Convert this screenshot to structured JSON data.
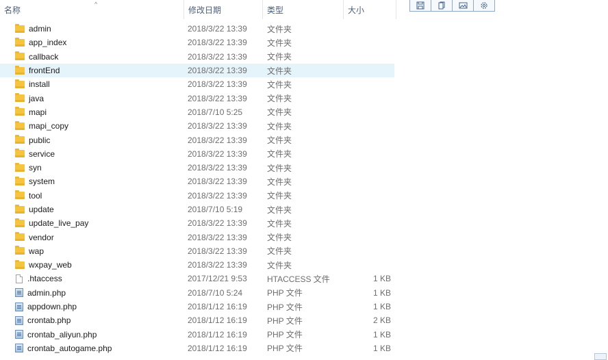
{
  "columns": {
    "name": "名称",
    "date": "修改日期",
    "type": "类型",
    "size": "大小"
  },
  "sort_indicator": "^",
  "toolbar": {
    "buttons": [
      "save-icon",
      "copy-icon",
      "image-icon",
      "settings-icon"
    ]
  },
  "files": [
    {
      "name": "admin",
      "date": "2018/3/22 13:39",
      "type": "文件夹",
      "size": "",
      "kind": "folder"
    },
    {
      "name": "app_index",
      "date": "2018/3/22 13:39",
      "type": "文件夹",
      "size": "",
      "kind": "folder"
    },
    {
      "name": "callback",
      "date": "2018/3/22 13:39",
      "type": "文件夹",
      "size": "",
      "kind": "folder"
    },
    {
      "name": "frontEnd",
      "date": "2018/3/22 13:39",
      "type": "文件夹",
      "size": "",
      "kind": "folder",
      "selected": true
    },
    {
      "name": "install",
      "date": "2018/3/22 13:39",
      "type": "文件夹",
      "size": "",
      "kind": "folder"
    },
    {
      "name": "java",
      "date": "2018/3/22 13:39",
      "type": "文件夹",
      "size": "",
      "kind": "folder"
    },
    {
      "name": "mapi",
      "date": "2018/7/10 5:25",
      "type": "文件夹",
      "size": "",
      "kind": "folder"
    },
    {
      "name": "mapi_copy",
      "date": "2018/3/22 13:39",
      "type": "文件夹",
      "size": "",
      "kind": "folder"
    },
    {
      "name": "public",
      "date": "2018/3/22 13:39",
      "type": "文件夹",
      "size": "",
      "kind": "folder"
    },
    {
      "name": "service",
      "date": "2018/3/22 13:39",
      "type": "文件夹",
      "size": "",
      "kind": "folder"
    },
    {
      "name": "syn",
      "date": "2018/3/22 13:39",
      "type": "文件夹",
      "size": "",
      "kind": "folder"
    },
    {
      "name": "system",
      "date": "2018/3/22 13:39",
      "type": "文件夹",
      "size": "",
      "kind": "folder"
    },
    {
      "name": "tool",
      "date": "2018/3/22 13:39",
      "type": "文件夹",
      "size": "",
      "kind": "folder"
    },
    {
      "name": "update",
      "date": "2018/7/10 5:19",
      "type": "文件夹",
      "size": "",
      "kind": "folder"
    },
    {
      "name": "update_live_pay",
      "date": "2018/3/22 13:39",
      "type": "文件夹",
      "size": "",
      "kind": "folder"
    },
    {
      "name": "vendor",
      "date": "2018/3/22 13:39",
      "type": "文件夹",
      "size": "",
      "kind": "folder"
    },
    {
      "name": "wap",
      "date": "2018/3/22 13:39",
      "type": "文件夹",
      "size": "",
      "kind": "folder"
    },
    {
      "name": "wxpay_web",
      "date": "2018/3/22 13:39",
      "type": "文件夹",
      "size": "",
      "kind": "folder"
    },
    {
      "name": ".htaccess",
      "date": "2017/12/21 9:53",
      "type": "HTACCESS 文件",
      "size": "1 KB",
      "kind": "file"
    },
    {
      "name": "admin.php",
      "date": "2018/7/10 5:24",
      "type": "PHP 文件",
      "size": "1 KB",
      "kind": "php"
    },
    {
      "name": "appdown.php",
      "date": "2018/1/12 16:19",
      "type": "PHP 文件",
      "size": "1 KB",
      "kind": "php"
    },
    {
      "name": "crontab.php",
      "date": "2018/1/12 16:19",
      "type": "PHP 文件",
      "size": "2 KB",
      "kind": "php"
    },
    {
      "name": "crontab_aliyun.php",
      "date": "2018/1/12 16:19",
      "type": "PHP 文件",
      "size": "1 KB",
      "kind": "php"
    },
    {
      "name": "crontab_autogame.php",
      "date": "2018/1/12 16:19",
      "type": "PHP 文件",
      "size": "1 KB",
      "kind": "php"
    }
  ]
}
